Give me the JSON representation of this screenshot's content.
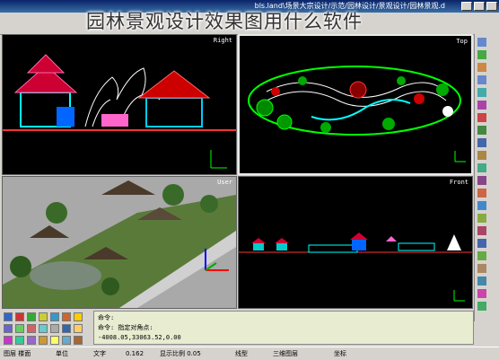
{
  "title_overlay": "园林景观设计效果图用什么软件",
  "window": {
    "title": "bls.land\\场景大宗设计/示范/园林设计/景观设计/园林景观.d"
  },
  "viewports": {
    "right": {
      "label": "Right"
    },
    "top": {
      "label": "Top"
    },
    "user": {
      "label": "User"
    },
    "front": {
      "label": "Front"
    }
  },
  "command_line": {
    "lines": [
      "命令:",
      "命令:  指定对角点:",
      "-4008.05,33063.52,0.00"
    ]
  },
  "status_bar": {
    "items": [
      "图层 楼面",
      "单位",
      "文字",
      "0.162",
      "显示比例 0.05",
      "线型",
      "三维图层",
      "坐标"
    ]
  },
  "colors": {
    "accent": "#0a246a",
    "viewport_bg": "#000000",
    "cmd_bg": "#e8ecd0",
    "cad_green": "#00ff00",
    "cad_red": "#ff0000",
    "cad_cyan": "#00ffff"
  }
}
